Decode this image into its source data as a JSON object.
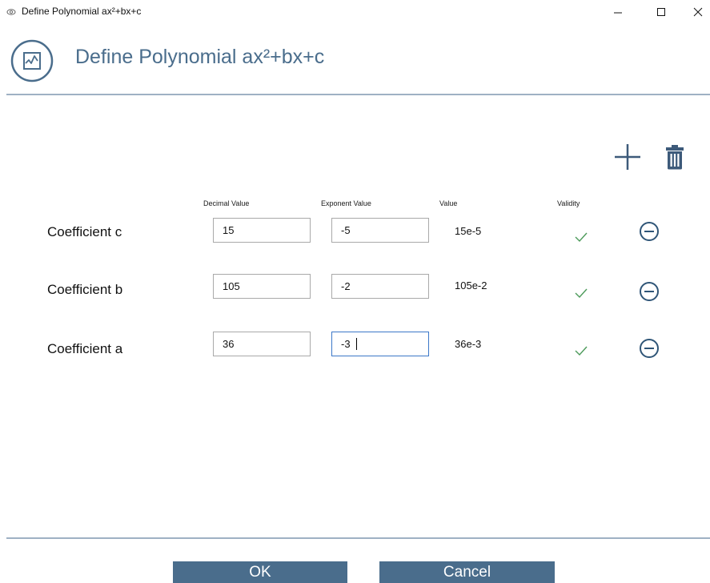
{
  "window": {
    "title": "Define Polynomial ax²+bx+c",
    "minimize_glyph": "—",
    "close_glyph": "✕"
  },
  "header": {
    "title": "Define Polynomial ax²+bx+c",
    "icon": "chart-icon"
  },
  "toolbar": {
    "add_icon": "plus-icon",
    "delete_icon": "trash-icon"
  },
  "columns": {
    "decimal": "Decimal Value",
    "exponent": "Exponent Value",
    "value": "Value",
    "validity": "Validity"
  },
  "rows": [
    {
      "label": "Coefficient c",
      "decimal": "15",
      "exponent": "-5",
      "value": "15e-5",
      "valid": true
    },
    {
      "label": "Coefficient b",
      "decimal": "105",
      "exponent": "-2",
      "value": "105e-2",
      "valid": true
    },
    {
      "label": "Coefficient a",
      "decimal": "36",
      "exponent": "-3",
      "value": "36e-3",
      "valid": true
    }
  ],
  "buttons": {
    "ok": "OK",
    "cancel": "Cancel"
  },
  "colors": {
    "accent": "#4a6d8c",
    "valid_check": "#4c9a5a",
    "divider": "#9fb1c4",
    "focus_border": "#3c78c8"
  }
}
